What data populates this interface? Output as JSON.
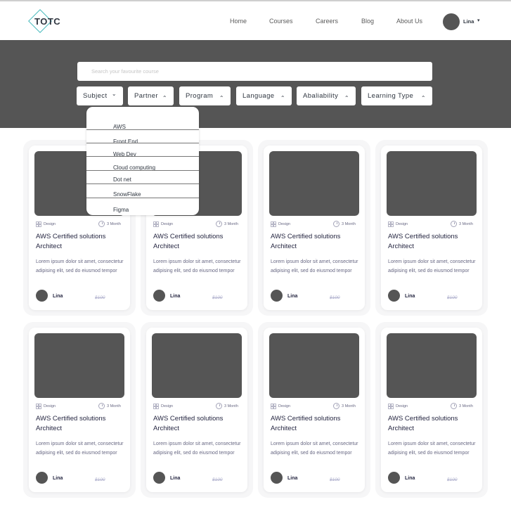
{
  "header": {
    "logo_text": "TOTC",
    "nav": [
      {
        "label": "Home"
      },
      {
        "label": "Courses"
      },
      {
        "label": "Careers"
      },
      {
        "label": "Blog"
      },
      {
        "label": "About Us"
      }
    ],
    "user_name": "Lina",
    "user_caret": "▾"
  },
  "search": {
    "placeholder": "Search your favourite course"
  },
  "filters": [
    {
      "label": "Subject",
      "chevron": "⌄"
    },
    {
      "label": "Partner",
      "chevron": "⌃"
    },
    {
      "label": "Program",
      "chevron": "⌃"
    },
    {
      "label": "Language",
      "chevron": "⌃"
    },
    {
      "label": "Abaliability",
      "chevron": "⌃"
    },
    {
      "label": "Learning Type",
      "chevron": "⌃"
    }
  ],
  "dropdown": {
    "items": [
      "AWS",
      "Front End",
      "Web Dev",
      "Cloud computing",
      "Dot net",
      "SnowFlake",
      "Figma"
    ]
  },
  "card": {
    "tag": "Design",
    "duration": "3 Month",
    "title": "AWS Certified solutions Architect",
    "description": "Lorem ipsum dolor sit amet, consectetur adipising elit, sed do eiusmod tempor",
    "author": "Lina",
    "price": "$100"
  },
  "colors": {
    "hero_bg": "#555555",
    "accent": "#49bbbd",
    "placeholder_block": "#555555"
  }
}
